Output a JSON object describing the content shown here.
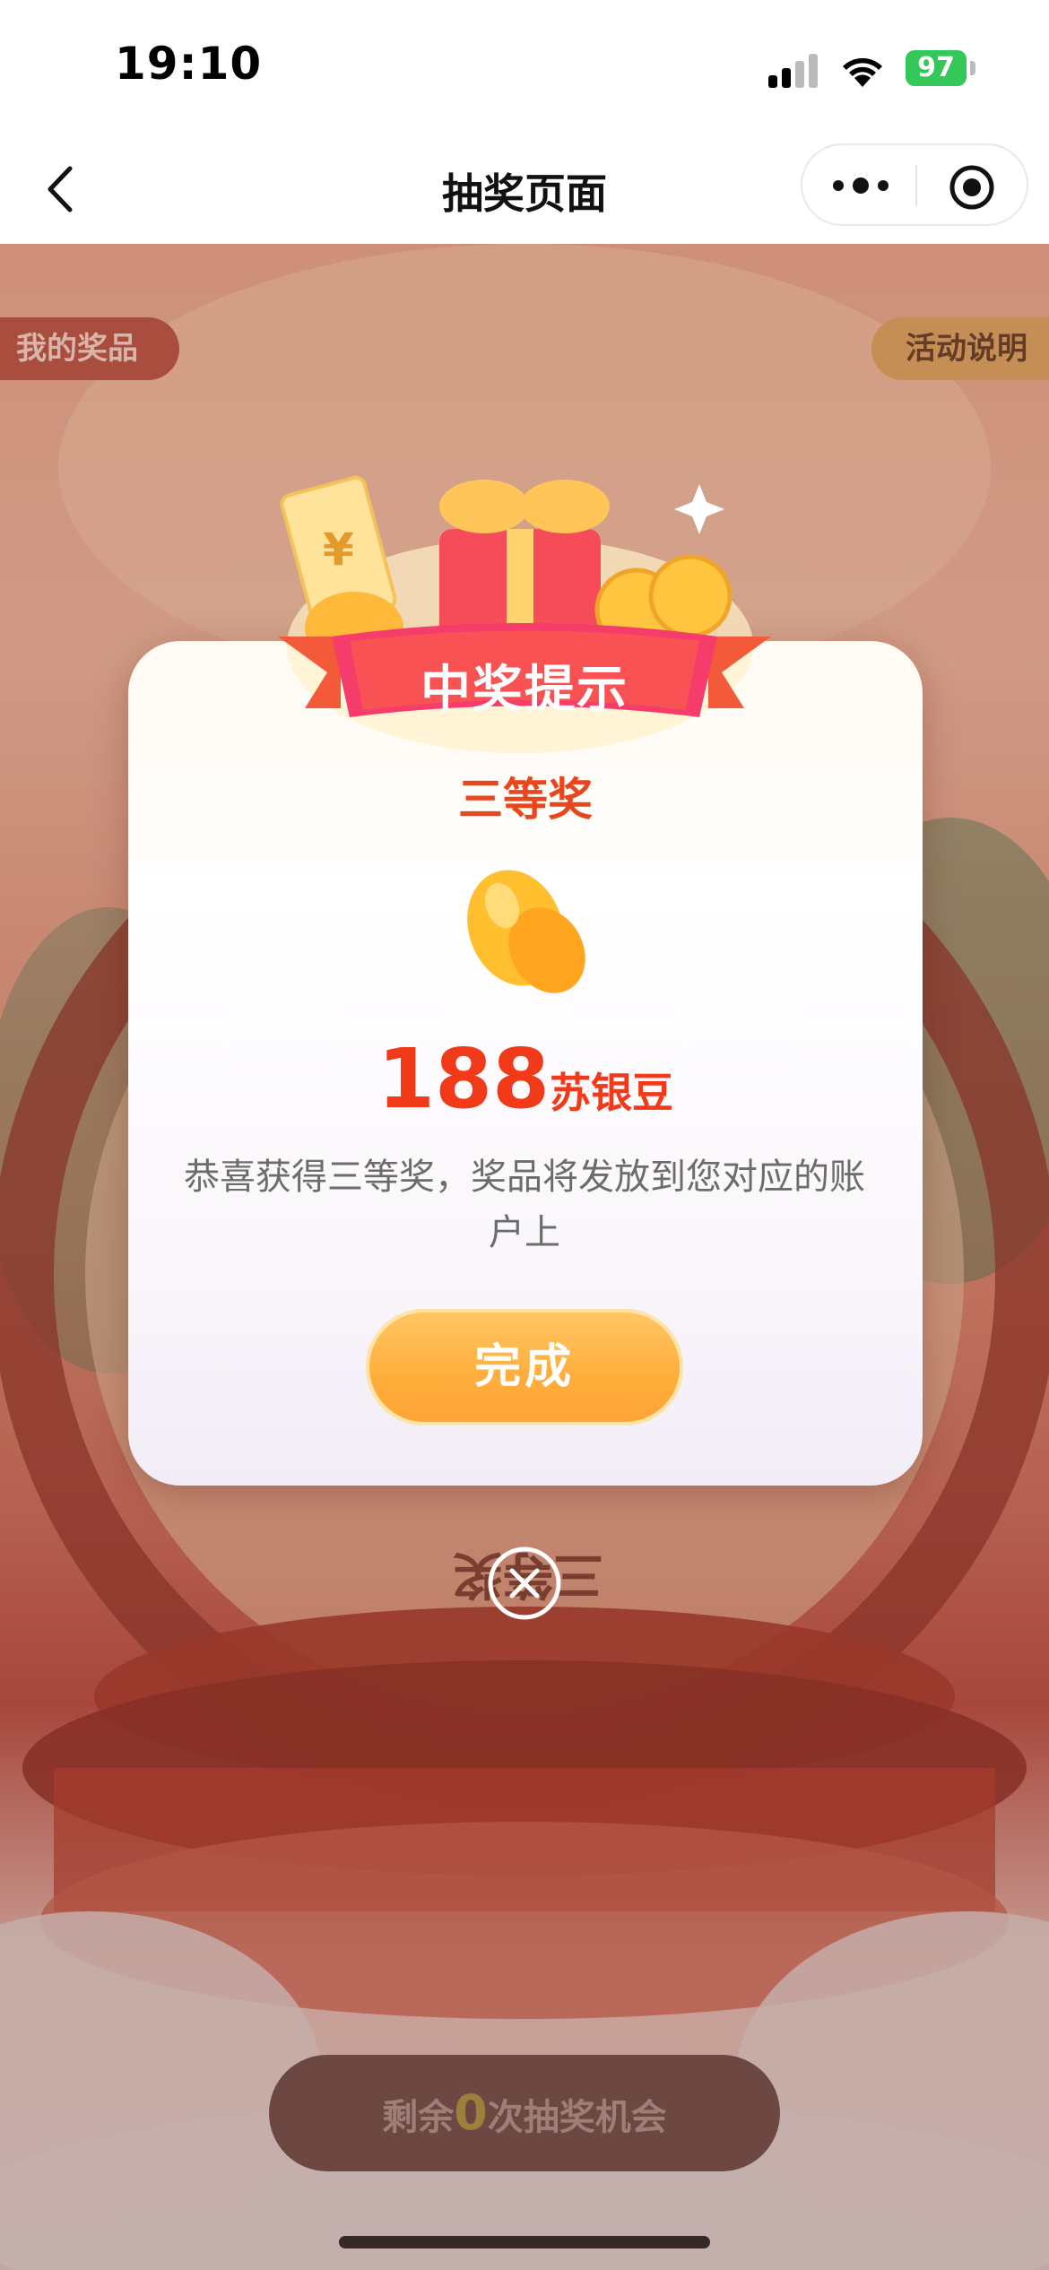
{
  "status_bar": {
    "time": "19:10",
    "battery": "97"
  },
  "nav": {
    "title": "抽奖页面"
  },
  "page": {
    "my_prizes": "我的奖品",
    "activity_rules": "活动说明",
    "wheel_prize_label": "三等奖",
    "remaining_prefix": "剩余",
    "remaining_count": "0",
    "remaining_suffix": "次抽奖机会"
  },
  "modal": {
    "title": "中奖提示",
    "prize_level": "三等奖",
    "amount": "188",
    "unit": "苏银豆",
    "description": "恭喜获得三等奖，奖品将发放到您对应的账户上",
    "done_label": "完成"
  },
  "colors": {
    "accent_red": "#f03a1a",
    "button_orange": "#ffad3b",
    "banner_pink": "#f0406a",
    "battery_green": "#34c759"
  },
  "icons": [
    "back-arrow-icon",
    "more-dots-icon",
    "target-icon",
    "signal-icon",
    "wifi-icon",
    "battery-icon",
    "bean-icon",
    "close-circle-icon"
  ]
}
